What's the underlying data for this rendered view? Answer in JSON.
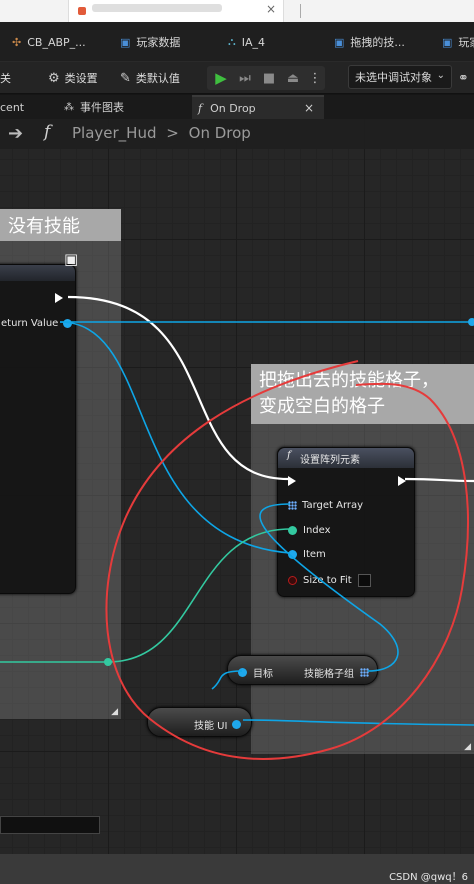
{
  "browser_tab": {
    "close": "×"
  },
  "asset_tabs": [
    {
      "label": "CB_ABP_...",
      "icon": "blueprint-icon"
    },
    {
      "label": "玩家数据",
      "icon": "struct-icon"
    },
    {
      "label": "IA_4",
      "icon": "input-action-icon"
    },
    {
      "label": "拖拽的技...",
      "icon": "widget-icon"
    },
    {
      "label": "玩家",
      "icon": "blueprint-icon"
    }
  ],
  "toolbar": {
    "partial_left": "关",
    "class_settings": "类设置",
    "class_defaults": "类默认值",
    "debug_target": "未选中调试对象",
    "more": "⋮"
  },
  "graph_tabs": {
    "recent": "cent",
    "event_graph": "事件图表",
    "on_drop": "On Drop",
    "close": "×"
  },
  "breadcrumb": {
    "function_symbol": "f",
    "path": "Player_Hud",
    "separator": ">",
    "current": "On Drop"
  },
  "comments": {
    "left_title": "没有技能",
    "right_title": "把拖出去的技能格子，",
    "right_title_line2": "变成空白的格子"
  },
  "left_node": {
    "return_value": "eturn Value"
  },
  "set_array_node": {
    "title": "设置阵列元素",
    "target_array": "Target Array",
    "index": "Index",
    "item": "Item",
    "size_to_fit": "Size to Fit"
  },
  "target_node": {
    "target": "目标",
    "skill_grid_group": "技能格子组"
  },
  "skill_ui_node": {
    "label": "技能 UI"
  },
  "watermark": "CSDN @qwq！6",
  "colors": {
    "exec_wire": "#ffffff",
    "object_wire": "#0ea5e6",
    "int_wire": "#33c9a0",
    "annotation_red": "#e53b3b"
  }
}
